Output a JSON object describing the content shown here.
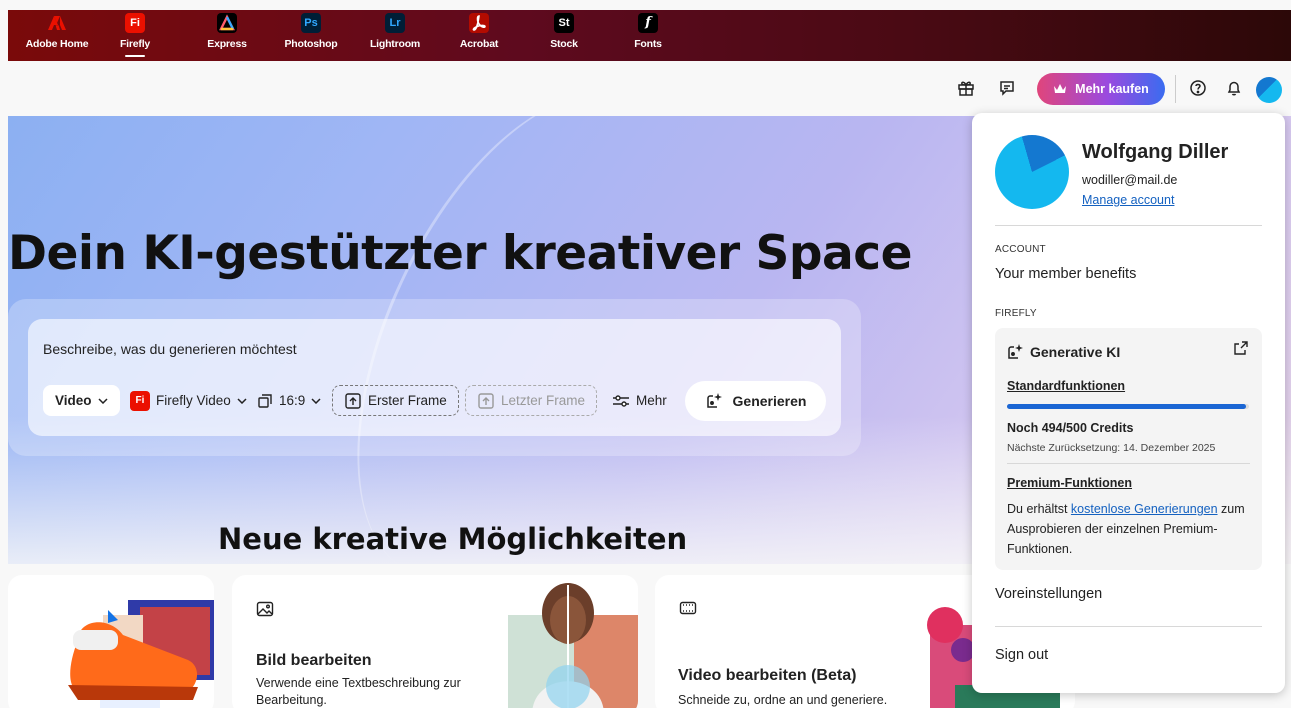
{
  "app_switcher": {
    "apps": [
      {
        "label": "Adobe Home",
        "glyph": "",
        "icon": "adobe-logo-icon",
        "color": "#eb1000"
      },
      {
        "label": "Firefly",
        "glyph": "Fi",
        "icon": "firefly-app-icon",
        "color": "#eb1000"
      },
      {
        "label": "Express",
        "glyph": "",
        "icon": "express-app-icon",
        "color": "#000000"
      },
      {
        "label": "Photoshop",
        "glyph": "Ps",
        "icon": "photoshop-app-icon",
        "color": "#0b2a4a"
      },
      {
        "label": "Lightroom",
        "glyph": "Lr",
        "icon": "lightroom-app-icon",
        "color": "#0b2a4a"
      },
      {
        "label": "Acrobat",
        "glyph": "",
        "icon": "acrobat-app-icon",
        "color": "#b30b00"
      },
      {
        "label": "Stock",
        "glyph": "St",
        "icon": "stock-app-icon",
        "color": "#000000"
      },
      {
        "label": "Fonts",
        "glyph": "f",
        "icon": "fonts-app-icon",
        "color": "#000000"
      }
    ],
    "active": "Firefly"
  },
  "toolbar": {
    "buy_label": "Mehr kaufen",
    "icons": [
      "gift-icon",
      "feedback-icon",
      "crown-icon",
      "help-icon",
      "bell-icon",
      "avatar"
    ]
  },
  "hero": {
    "title": "Dein KI-gestützter kreativer Space",
    "prompt_placeholder": "Beschreibe, was du generieren möchtest",
    "type_label": "Video",
    "model_label": "Firefly Video",
    "model_badge": "Fi",
    "aspect_label": "16:9",
    "first_frame": "Erster Frame",
    "last_frame": "Letzter Frame",
    "more_label": "Mehr",
    "generate_label": "Generieren"
  },
  "section": {
    "title": "Neue kreative Möglichkeiten"
  },
  "cards": [
    {
      "title": "Bild bearbeiten",
      "desc": "Verwende eine Textbeschreibung zur Bearbeitung.",
      "icon": "image-icon"
    },
    {
      "title": "Video bearbeiten (Beta)",
      "desc": "Schneide zu, ordne an und generiere.",
      "icon": "film-icon"
    }
  ],
  "profile": {
    "name": "Wolfgang Diller",
    "email": "wodiller@mail.de",
    "manage_account": "Manage account",
    "account_heading": "ACCOUNT",
    "member_benefits": "Your member benefits",
    "firefly_heading": "FIREFLY",
    "generative_title": "Generative KI",
    "standard_link": "Standardfunktionen",
    "credits_used_fraction": 0.988,
    "credits_text": "Noch 494/500 Credits",
    "reset_text": "Nächste Zurücksetzung: 14. Dezember 2025",
    "premium_link": "Premium-Funktionen",
    "premium_desc_before": "Du erhältst ",
    "premium_desc_link": "kostenlose Generierungen",
    "premium_desc_after": " zum Ausprobieren der einzelnen Premium-Funktionen.",
    "preferences": "Voreinstellungen",
    "sign_out": "Sign out"
  },
  "colors": {
    "accent_blue": "#1b66d4",
    "link_blue": "#1461c0",
    "adobe_red": "#eb1000"
  }
}
